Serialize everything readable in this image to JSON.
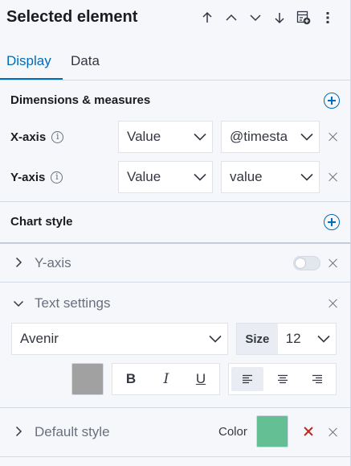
{
  "header": {
    "title": "Selected element",
    "icons": [
      "arrow-up-icon",
      "chevron-up-icon",
      "chevron-down-icon",
      "arrow-down-icon",
      "add-element-icon",
      "more-vertical-icon"
    ]
  },
  "tabs": [
    {
      "label": "Display",
      "active": true
    },
    {
      "label": "Data",
      "active": false
    }
  ],
  "dimensions": {
    "title": "Dimensions & measures",
    "rows": [
      {
        "label": "X-axis",
        "function": "Value",
        "field": "@timesta"
      },
      {
        "label": "Y-axis",
        "function": "Value",
        "field": "value"
      }
    ]
  },
  "chart_style": {
    "title": "Chart style"
  },
  "yaxis_section": {
    "title": "Y-axis",
    "enabled": false
  },
  "text_settings": {
    "title": "Text settings",
    "font": "Avenir",
    "size_label": "Size",
    "size_value": "12",
    "text_color": "#a1a1a1",
    "format": {
      "bold": "B",
      "italic": "I",
      "underline": "U"
    },
    "alignment_selected": "left"
  },
  "default_style": {
    "title": "Default style",
    "color_label": "Color",
    "color": "#64bf94"
  }
}
